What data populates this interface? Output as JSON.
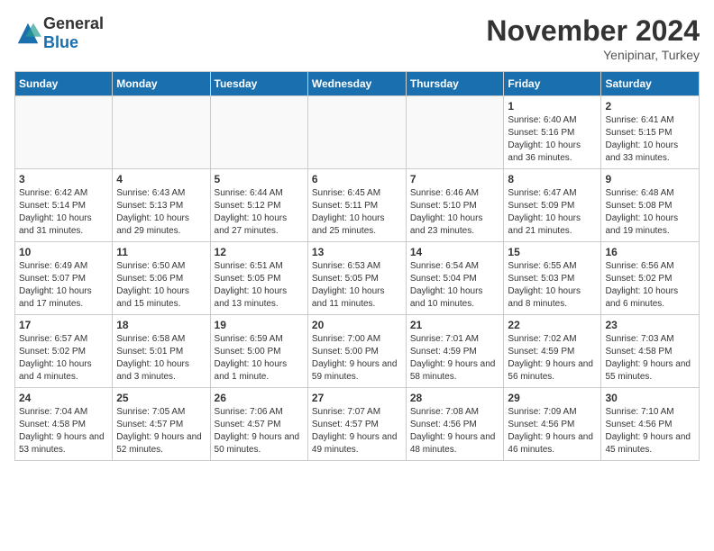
{
  "logo": {
    "general": "General",
    "blue": "Blue"
  },
  "title": "November 2024",
  "location": "Yenipinar, Turkey",
  "days_of_week": [
    "Sunday",
    "Monday",
    "Tuesday",
    "Wednesday",
    "Thursday",
    "Friday",
    "Saturday"
  ],
  "weeks": [
    [
      {
        "day": "",
        "info": ""
      },
      {
        "day": "",
        "info": ""
      },
      {
        "day": "",
        "info": ""
      },
      {
        "day": "",
        "info": ""
      },
      {
        "day": "",
        "info": ""
      },
      {
        "day": "1",
        "info": "Sunrise: 6:40 AM\nSunset: 5:16 PM\nDaylight: 10 hours and 36 minutes."
      },
      {
        "day": "2",
        "info": "Sunrise: 6:41 AM\nSunset: 5:15 PM\nDaylight: 10 hours and 33 minutes."
      }
    ],
    [
      {
        "day": "3",
        "info": "Sunrise: 6:42 AM\nSunset: 5:14 PM\nDaylight: 10 hours and 31 minutes."
      },
      {
        "day": "4",
        "info": "Sunrise: 6:43 AM\nSunset: 5:13 PM\nDaylight: 10 hours and 29 minutes."
      },
      {
        "day": "5",
        "info": "Sunrise: 6:44 AM\nSunset: 5:12 PM\nDaylight: 10 hours and 27 minutes."
      },
      {
        "day": "6",
        "info": "Sunrise: 6:45 AM\nSunset: 5:11 PM\nDaylight: 10 hours and 25 minutes."
      },
      {
        "day": "7",
        "info": "Sunrise: 6:46 AM\nSunset: 5:10 PM\nDaylight: 10 hours and 23 minutes."
      },
      {
        "day": "8",
        "info": "Sunrise: 6:47 AM\nSunset: 5:09 PM\nDaylight: 10 hours and 21 minutes."
      },
      {
        "day": "9",
        "info": "Sunrise: 6:48 AM\nSunset: 5:08 PM\nDaylight: 10 hours and 19 minutes."
      }
    ],
    [
      {
        "day": "10",
        "info": "Sunrise: 6:49 AM\nSunset: 5:07 PM\nDaylight: 10 hours and 17 minutes."
      },
      {
        "day": "11",
        "info": "Sunrise: 6:50 AM\nSunset: 5:06 PM\nDaylight: 10 hours and 15 minutes."
      },
      {
        "day": "12",
        "info": "Sunrise: 6:51 AM\nSunset: 5:05 PM\nDaylight: 10 hours and 13 minutes."
      },
      {
        "day": "13",
        "info": "Sunrise: 6:53 AM\nSunset: 5:05 PM\nDaylight: 10 hours and 11 minutes."
      },
      {
        "day": "14",
        "info": "Sunrise: 6:54 AM\nSunset: 5:04 PM\nDaylight: 10 hours and 10 minutes."
      },
      {
        "day": "15",
        "info": "Sunrise: 6:55 AM\nSunset: 5:03 PM\nDaylight: 10 hours and 8 minutes."
      },
      {
        "day": "16",
        "info": "Sunrise: 6:56 AM\nSunset: 5:02 PM\nDaylight: 10 hours and 6 minutes."
      }
    ],
    [
      {
        "day": "17",
        "info": "Sunrise: 6:57 AM\nSunset: 5:02 PM\nDaylight: 10 hours and 4 minutes."
      },
      {
        "day": "18",
        "info": "Sunrise: 6:58 AM\nSunset: 5:01 PM\nDaylight: 10 hours and 3 minutes."
      },
      {
        "day": "19",
        "info": "Sunrise: 6:59 AM\nSunset: 5:00 PM\nDaylight: 10 hours and 1 minute."
      },
      {
        "day": "20",
        "info": "Sunrise: 7:00 AM\nSunset: 5:00 PM\nDaylight: 9 hours and 59 minutes."
      },
      {
        "day": "21",
        "info": "Sunrise: 7:01 AM\nSunset: 4:59 PM\nDaylight: 9 hours and 58 minutes."
      },
      {
        "day": "22",
        "info": "Sunrise: 7:02 AM\nSunset: 4:59 PM\nDaylight: 9 hours and 56 minutes."
      },
      {
        "day": "23",
        "info": "Sunrise: 7:03 AM\nSunset: 4:58 PM\nDaylight: 9 hours and 55 minutes."
      }
    ],
    [
      {
        "day": "24",
        "info": "Sunrise: 7:04 AM\nSunset: 4:58 PM\nDaylight: 9 hours and 53 minutes."
      },
      {
        "day": "25",
        "info": "Sunrise: 7:05 AM\nSunset: 4:57 PM\nDaylight: 9 hours and 52 minutes."
      },
      {
        "day": "26",
        "info": "Sunrise: 7:06 AM\nSunset: 4:57 PM\nDaylight: 9 hours and 50 minutes."
      },
      {
        "day": "27",
        "info": "Sunrise: 7:07 AM\nSunset: 4:57 PM\nDaylight: 9 hours and 49 minutes."
      },
      {
        "day": "28",
        "info": "Sunrise: 7:08 AM\nSunset: 4:56 PM\nDaylight: 9 hours and 48 minutes."
      },
      {
        "day": "29",
        "info": "Sunrise: 7:09 AM\nSunset: 4:56 PM\nDaylight: 9 hours and 46 minutes."
      },
      {
        "day": "30",
        "info": "Sunrise: 7:10 AM\nSunset: 4:56 PM\nDaylight: 9 hours and 45 minutes."
      }
    ]
  ]
}
